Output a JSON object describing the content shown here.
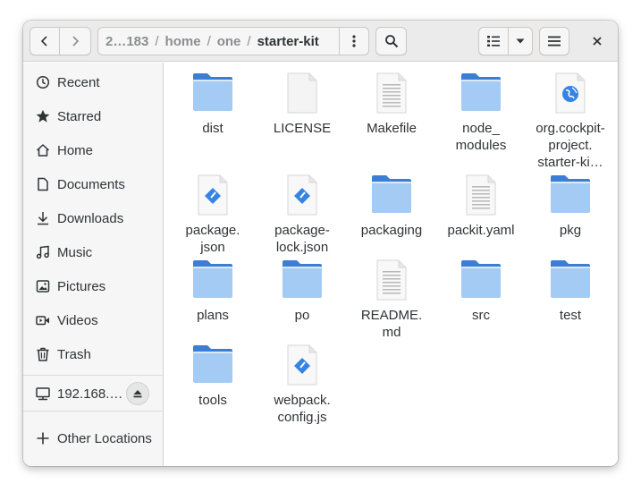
{
  "window": {
    "title": "starter-kit"
  },
  "pathbar": {
    "crumbs": [
      "2…183",
      "home",
      "one",
      "starter-kit"
    ],
    "separator": "/"
  },
  "toolbar": {
    "back_icon": "go-previous-icon",
    "forward_icon": "go-next-icon",
    "path_menu_icon": "view-more-icon",
    "search_icon": "search-icon",
    "view_icon": "list-view-icon",
    "view_dropdown_icon": "pan-down-icon",
    "menu_icon": "hamburger-menu-icon",
    "close_icon": "close-icon"
  },
  "sidebar": {
    "items": [
      {
        "label": "Recent",
        "icon": "clock-icon"
      },
      {
        "label": "Starred",
        "icon": "star-icon"
      },
      {
        "label": "Home",
        "icon": "home-icon"
      },
      {
        "label": "Documents",
        "icon": "document-icon"
      },
      {
        "label": "Downloads",
        "icon": "download-icon"
      },
      {
        "label": "Music",
        "icon": "music-icon"
      },
      {
        "label": "Pictures",
        "icon": "picture-icon"
      },
      {
        "label": "Videos",
        "icon": "video-icon"
      },
      {
        "label": "Trash",
        "icon": "trash-icon"
      }
    ],
    "network": {
      "label": "192.168.…",
      "icon": "network-drive-icon",
      "eject_icon": "eject-icon"
    },
    "other": {
      "label": "Other Locations",
      "icon": "plus-icon"
    }
  },
  "files": [
    {
      "name": "dist",
      "type": "folder"
    },
    {
      "name": "LICENSE",
      "type": "blank"
    },
    {
      "name": "Makefile",
      "type": "text"
    },
    {
      "name": "node_\nmodules",
      "type": "folder"
    },
    {
      "name": "org.cockpit-\nproject.\nstarter-ki…",
      "type": "web"
    },
    {
      "name": "package.\njson",
      "type": "script"
    },
    {
      "name": "package-\nlock.json",
      "type": "script"
    },
    {
      "name": "packaging",
      "type": "folder"
    },
    {
      "name": "packit.yaml",
      "type": "text"
    },
    {
      "name": "pkg",
      "type": "folder"
    },
    {
      "name": "plans",
      "type": "folder"
    },
    {
      "name": "po",
      "type": "folder"
    },
    {
      "name": "README.\nmd",
      "type": "text"
    },
    {
      "name": "src",
      "type": "folder"
    },
    {
      "name": "test",
      "type": "folder"
    },
    {
      "name": "tools",
      "type": "folder"
    },
    {
      "name": "webpack.\nconfig.js",
      "type": "script"
    }
  ],
  "colors": {
    "folder_body": "#a4cbf4",
    "folder_top": "#3a7fd4",
    "accent": "#3584e4"
  }
}
